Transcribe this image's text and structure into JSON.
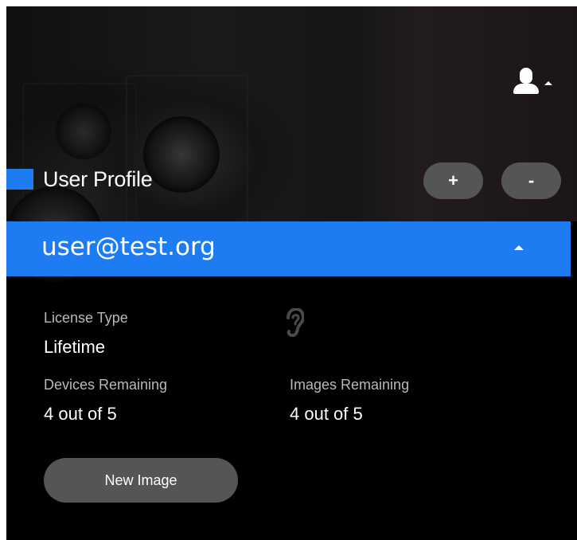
{
  "header": {
    "user_menu_icon": "user-icon",
    "user_menu_caret": "caret-up-icon"
  },
  "profile": {
    "title": "User Profile",
    "add_label": "+",
    "remove_label": "-",
    "accent_color": "#1e7cf2"
  },
  "account": {
    "email": "user@test.org",
    "expand_icon": "caret-up-icon"
  },
  "license": {
    "type_label": "License Type",
    "type_value": "Lifetime",
    "devices_label": "Devices Remaining",
    "devices_value": "4 out of 5",
    "images_label": "Images Remaining",
    "images_value": "4 out of 5",
    "status_icon": "ear-icon"
  },
  "actions": {
    "new_image_label": "New Image"
  }
}
